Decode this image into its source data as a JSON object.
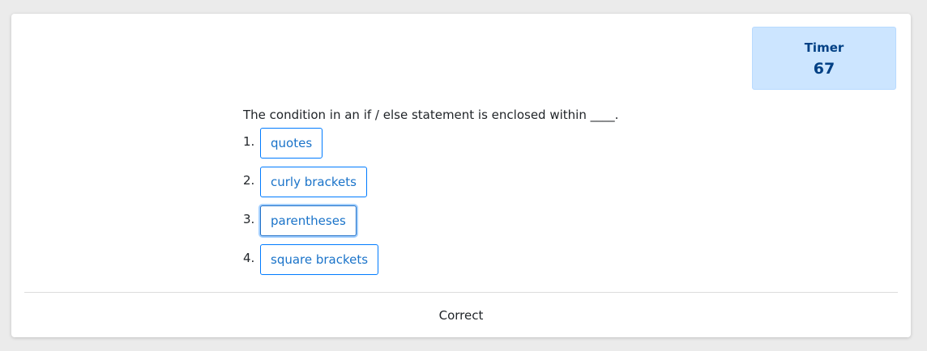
{
  "timer": {
    "label": "Timer",
    "value": "67"
  },
  "quiz": {
    "question": "The condition in an if / else statement is enclosed within ____.",
    "choices": [
      {
        "number": "1.",
        "label": "quotes"
      },
      {
        "number": "2.",
        "label": "curly brackets"
      },
      {
        "number": "3.",
        "label": "parentheses"
      },
      {
        "number": "4.",
        "label": "square brackets"
      }
    ],
    "result": "Correct"
  },
  "colors": {
    "accent": "#007bff",
    "timer_background": "#cce5ff",
    "timer_text": "#004085"
  }
}
